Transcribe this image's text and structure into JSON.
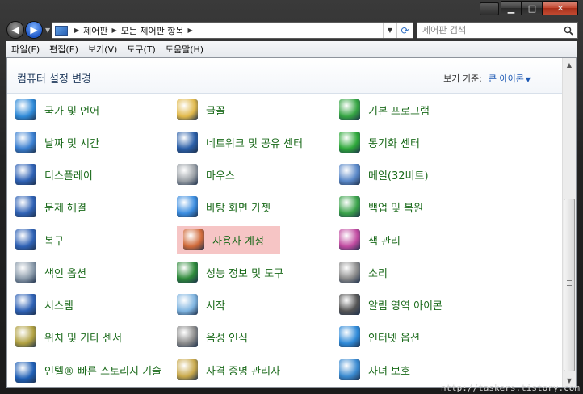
{
  "window": {
    "caption": {
      "minimize": "▁",
      "maximize": "□",
      "close": "✕"
    }
  },
  "nav": {
    "back_glyph": "◀",
    "forward_glyph": "▶",
    "breadcrumb": [
      "제어판",
      "모든 제어판 항목"
    ],
    "search_placeholder": "제어판 검색"
  },
  "menu": [
    "파일(F)",
    "편집(E)",
    "보기(V)",
    "도구(T)",
    "도움말(H)"
  ],
  "header": {
    "title": "컴퓨터 설정 변경",
    "view_by_label": "보기 기준:",
    "view_by_value": "큰 아이콘"
  },
  "items": [
    {
      "label": "국가 및 언어",
      "icon": "globe-clock-icon",
      "color": "#2f8ad8"
    },
    {
      "label": "글꼴",
      "icon": "font-folder-icon",
      "color": "#e0b84a"
    },
    {
      "label": "기본 프로그램",
      "icon": "default-programs-icon",
      "color": "#35a543"
    },
    {
      "label": "날짜 및 시간",
      "icon": "calendar-clock-icon",
      "color": "#3a7fd0"
    },
    {
      "label": "네트워크 및 공유 센터",
      "icon": "network-icon",
      "color": "#2b5fa8"
    },
    {
      "label": "동기화 센터",
      "icon": "sync-icon",
      "color": "#2ea83a"
    },
    {
      "label": "디스플레이",
      "icon": "display-icon",
      "color": "#2f62b5"
    },
    {
      "label": "마우스",
      "icon": "mouse-icon",
      "color": "#9aa0a6"
    },
    {
      "label": "메일(32비트)",
      "icon": "mail-icon",
      "color": "#5a88c8"
    },
    {
      "label": "문제 해결",
      "icon": "troubleshoot-icon",
      "color": "#2f62b5"
    },
    {
      "label": "바탕 화면 가젯",
      "icon": "gadgets-icon",
      "color": "#3b8de0"
    },
    {
      "label": "백업 및 복원",
      "icon": "backup-icon",
      "color": "#3aa24a"
    },
    {
      "label": "복구",
      "icon": "recovery-icon",
      "color": "#2f62b5"
    },
    {
      "label": "사용자 계정",
      "icon": "user-accounts-icon",
      "color": "#d06a3a",
      "highlight": "#f6c5c5"
    },
    {
      "label": "색 관리",
      "icon": "color-management-icon",
      "color": "#c04aa0"
    },
    {
      "label": "색인 옵션",
      "icon": "indexing-icon",
      "color": "#8a9aaa"
    },
    {
      "label": "성능 정보 및 도구",
      "icon": "performance-icon",
      "color": "#2e8a3a"
    },
    {
      "label": "소리",
      "icon": "sound-icon",
      "color": "#8a8a8a"
    },
    {
      "label": "시스템",
      "icon": "system-icon",
      "color": "#2f62b5"
    },
    {
      "label": "시작",
      "icon": "getting-started-icon",
      "color": "#7fb4e0"
    },
    {
      "label": "알림 영역 아이콘",
      "icon": "notification-icon",
      "color": "#555555"
    },
    {
      "label": "위치 및 기타 센서",
      "icon": "sensor-icon",
      "color": "#b0a040"
    },
    {
      "label": "음성 인식",
      "icon": "microphone-icon",
      "color": "#8a8a8a"
    },
    {
      "label": "인터넷 옵션",
      "icon": "internet-options-icon",
      "color": "#2f8ad8"
    },
    {
      "label": "인텔® 빠른 스토리지 기술",
      "icon": "intel-storage-icon",
      "color": "#1f5fb5"
    },
    {
      "label": "자격 증명 관리자",
      "icon": "credential-icon",
      "color": "#c8a84a"
    },
    {
      "label": "자녀 보호",
      "icon": "parental-controls-icon",
      "color": "#3a8ad0"
    }
  ],
  "watermark": "http://taskers.tistory.com"
}
